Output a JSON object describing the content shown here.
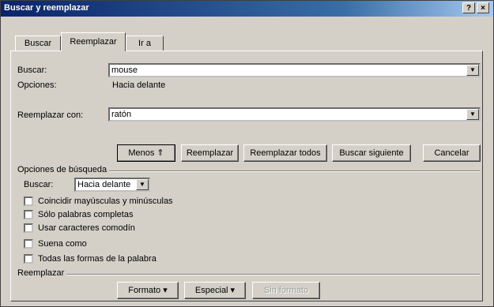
{
  "window": {
    "title": "Buscar y reemplazar",
    "help_button": "?",
    "close_button": "×"
  },
  "tabs": [
    {
      "label": "Buscar",
      "active": false
    },
    {
      "label": "Reemplazar",
      "active": true
    },
    {
      "label": "Ir a",
      "active": false
    }
  ],
  "find": {
    "label": "Buscar:",
    "value": "mouse",
    "options_label": "Opciones:",
    "options_value": "Hacia delante"
  },
  "replace": {
    "label": "Reemplazar con:",
    "value": "ratón"
  },
  "buttons": {
    "less": "Menos ⇑",
    "replace": "Reemplazar",
    "replace_all": "Reemplazar todos",
    "find_next": "Buscar siguiente",
    "cancel": "Cancelar"
  },
  "search_options": {
    "group_label": "Opciones de búsqueda",
    "direction_label": "Buscar:",
    "direction_value": "Hacia delante",
    "checkboxes": [
      {
        "label": "Coincidir mayúsculas y minúsculas",
        "checked": false
      },
      {
        "label": "Sólo palabras completas",
        "checked": false
      },
      {
        "label": "Usar caracteres comodín",
        "checked": false
      },
      {
        "label": "Suena como",
        "checked": false
      },
      {
        "label": "Todas las formas de la palabra",
        "checked": false
      }
    ]
  },
  "replace_section": {
    "group_label": "Reemplazar",
    "format_button": "Formato ▾",
    "special_button": "Especial ▾",
    "no_format_button": "Sin formato"
  },
  "icons": {
    "dropdown": "down-arrow",
    "help": "question-mark",
    "close": "x"
  }
}
